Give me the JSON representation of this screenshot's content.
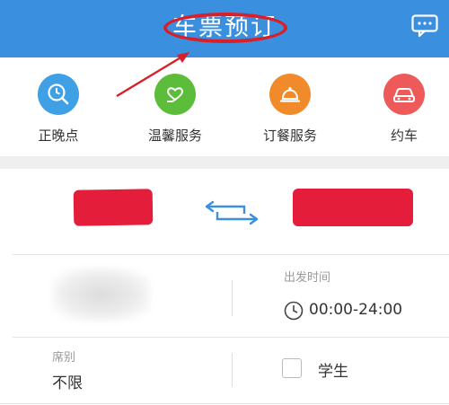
{
  "header": {
    "title": "车票预订",
    "icon": "message-icon",
    "background": "#3a8fdf"
  },
  "services": [
    {
      "label": "正晚点",
      "icon": "clock-search-icon",
      "color": "#3fa0e6"
    },
    {
      "label": "温馨服务",
      "icon": "heart-hand-icon",
      "color": "#5cbd3a"
    },
    {
      "label": "订餐服务",
      "icon": "food-cloche-icon",
      "color": "#f08a2a"
    },
    {
      "label": "约车",
      "icon": "car-icon",
      "color": "#ee5a5a"
    }
  ],
  "route": {
    "swap_icon": "swap-arrows-icon"
  },
  "fields": {
    "departure_time_label": "出发时间",
    "departure_time_value": "00:00-24:00",
    "seat_label": "席别",
    "seat_value": "不限",
    "student_label": "学生"
  },
  "annotation_color": "#d7202a"
}
